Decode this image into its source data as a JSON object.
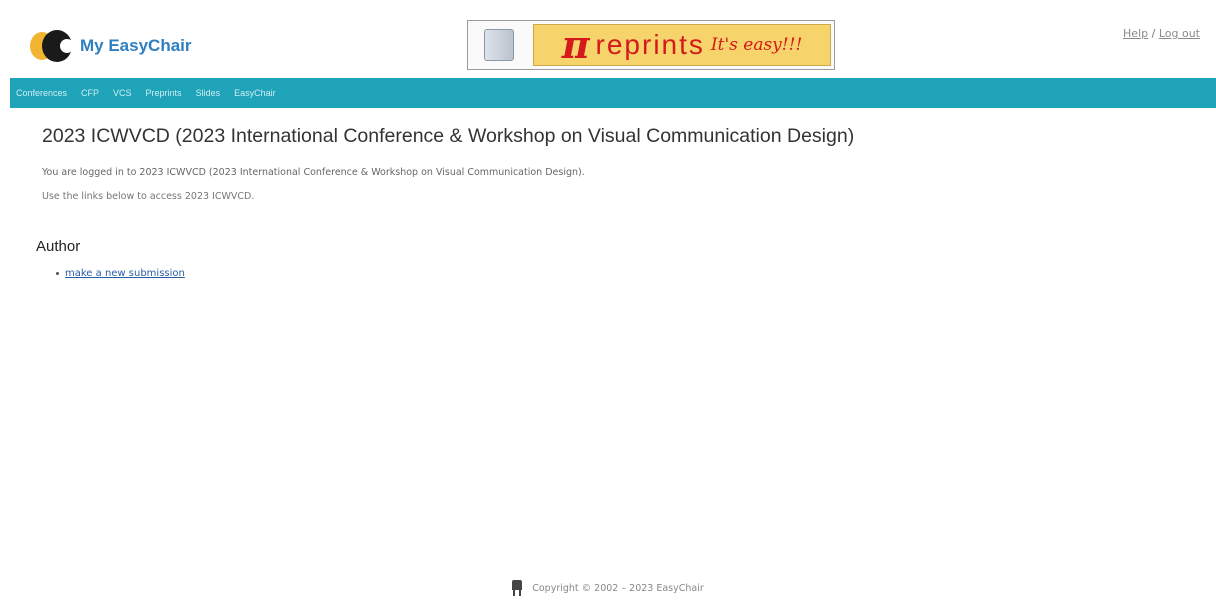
{
  "header": {
    "logo_text": "My EasyChair",
    "banner": {
      "pi_glyph": "π",
      "brand": "reprints",
      "tagline": "It's easy!!!"
    },
    "help_link": "Help",
    "separator": "/",
    "logout_link": "Log out"
  },
  "navbar": {
    "items": [
      "Conferences",
      "CFP",
      "VCS",
      "Preprints",
      "Slides",
      "EasyChair"
    ]
  },
  "main": {
    "title": "2023 ICWVCD (2023 International Conference & Workshop on Visual Communication Design)",
    "logged_in_text": "You are logged in to 2023 ICWVCD (2023 International Conference & Workshop on Visual Communication Design).",
    "instructions_text": "Use the links below to access 2023 ICWVCD.",
    "author_heading": "Author",
    "author_links": [
      "make a new submission"
    ]
  },
  "footer": {
    "copyright": "Copyright © 2002 – 2023 EasyChair"
  },
  "colors": {
    "navbar_bg": "#1ea3b8",
    "logo_text": "#2f7fc1",
    "banner_bg": "#f6d36b",
    "banner_text": "#d41a1a",
    "link": "#2a5ea3"
  }
}
